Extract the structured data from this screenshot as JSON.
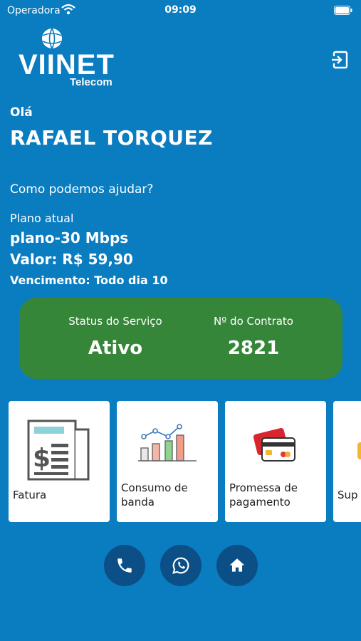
{
  "status_bar": {
    "carrier": "Operadora",
    "time": "09:09"
  },
  "logo": {
    "brand": "VIINET",
    "tagline": "Telecom"
  },
  "header": {
    "logout_icon": "logout-icon"
  },
  "user": {
    "greeting": "Olá",
    "name": "RAFAEL TORQUEZ",
    "help_text": "Como podemos ajudar?"
  },
  "plan": {
    "label": "Plano atual",
    "name": "plano-30 Mbps",
    "value": "Valor: R$ 59,90",
    "due": "Vencimento: Todo dia 10"
  },
  "service": {
    "status_label": "Status do Serviço",
    "status_value": "Ativo",
    "contract_label": "Nº do Contrato",
    "contract_value": "2821",
    "card_color": "#36863a"
  },
  "cards": [
    {
      "label": "Fatura",
      "icon": "invoice-icon"
    },
    {
      "label": "Consumo de banda",
      "icon": "bandwidth-chart-icon"
    },
    {
      "label": "Promessa de pagamento",
      "icon": "credit-card-icon"
    },
    {
      "label": "Sup",
      "icon": "support-icon"
    }
  ],
  "bottom_buttons": [
    {
      "icon": "phone-icon"
    },
    {
      "icon": "whatsapp-icon"
    },
    {
      "icon": "home-icon"
    }
  ],
  "colors": {
    "background": "#0a7cc0",
    "button": "#0b4f86"
  }
}
